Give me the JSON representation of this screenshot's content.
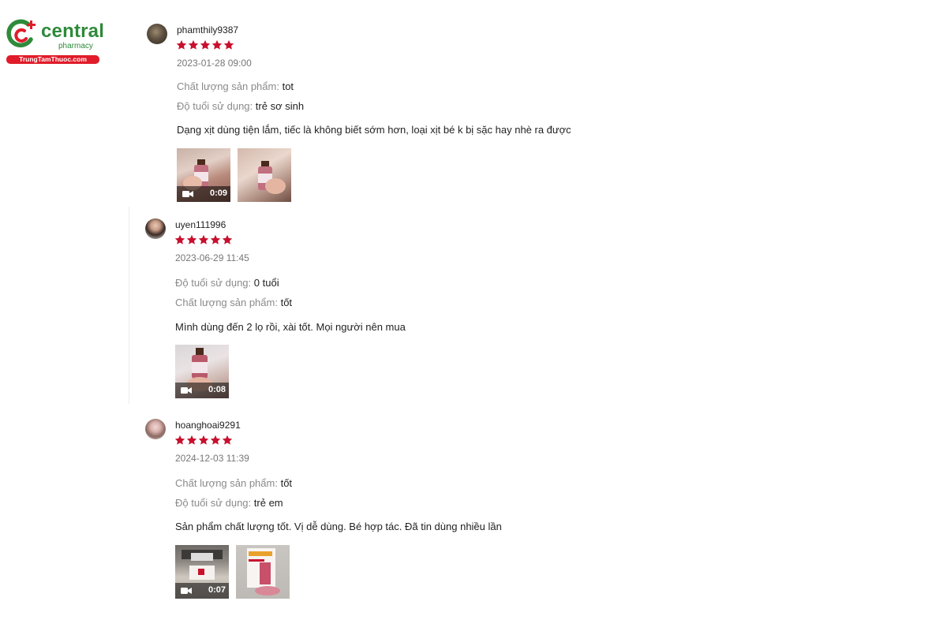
{
  "logo": {
    "brand": "central",
    "tagline": "pharmacy",
    "site": "TrungTamThuoc.com",
    "colors": {
      "green": "#2f8a3a",
      "red": "#e01c2a"
    }
  },
  "ui": {
    "star_color": "#c8102e"
  },
  "reviews": [
    {
      "username": "phamthily9387",
      "rating": 5,
      "date": "2023-01-28 09:00",
      "attrs": [
        {
          "label": "Chất lượng sản phẩm:",
          "value": "tot"
        },
        {
          "label": "Độ tuổi sử dụng:",
          "value": "trẻ sơ sinh"
        }
      ],
      "comment": "Dạng xịt dùng tiện lắm, tiếc là không biết sớm hơn, loại xịt bé k bị sặc hay nhè ra được",
      "media": [
        {
          "type": "video",
          "duration": "0:09"
        },
        {
          "type": "image"
        }
      ]
    },
    {
      "username": "uyen111996",
      "rating": 5,
      "date": "2023-06-29 11:45",
      "attrs": [
        {
          "label": "Độ tuổi sử dụng:",
          "value": "0 tuổi"
        },
        {
          "label": "Chất lượng sản phẩm:",
          "value": "tốt"
        }
      ],
      "comment": "Mình dùng đến 2 lọ rồi, xài tốt. Mọi người nên mua",
      "media": [
        {
          "type": "video",
          "duration": "0:08"
        }
      ]
    },
    {
      "username": "hoanghoai9291",
      "rating": 5,
      "date": "2024-12-03 11:39",
      "attrs": [
        {
          "label": "Chất lượng sản phẩm:",
          "value": "tốt"
        },
        {
          "label": "Độ tuổi sử dụng:",
          "value": "trẻ em"
        }
      ],
      "comment": "Sản phẩm chất lượng tốt. Vị dễ dùng. Bé hợp tác. Đã tin dùng nhiều lần",
      "media": [
        {
          "type": "video",
          "duration": "0:07"
        },
        {
          "type": "image"
        }
      ]
    }
  ]
}
